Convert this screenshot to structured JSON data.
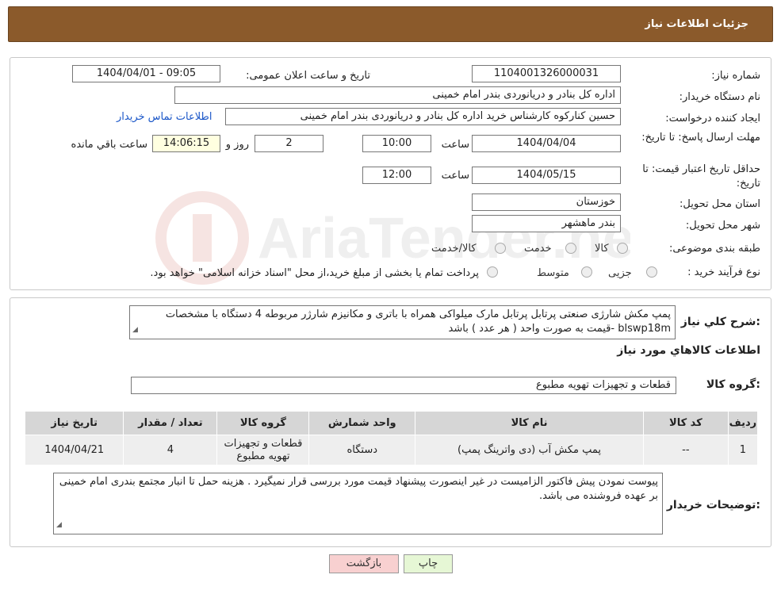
{
  "header": {
    "title": "جزئیات اطلاعات نیاز"
  },
  "form": {
    "need_number_label": "شماره نیاز:",
    "need_number": "1104001326000031",
    "announce_label": "تاریخ و ساعت اعلان عمومی:",
    "announce_value": "1404/04/01 - 09:05",
    "buyer_org_label": "نام دستگاه خریدار:",
    "buyer_org": "اداره کل بنادر و دریانوردی بندر امام خمینی",
    "creator_label": "ایجاد کننده درخواست:",
    "creator": "حسین کنارکوه کارشناس خرید اداره کل بنادر و دریانوردی بندر امام خمینی",
    "contact_link": "اطلاعات تماس خریدار",
    "deadline_label": "مهلت ارسال پاسخ: تا تاریخ:",
    "deadline_date": "1404/04/04",
    "time_label": "ساعت",
    "deadline_time": "10:00",
    "days_value": "2",
    "days_label": "روز و",
    "remaining_time": "14:06:15",
    "remaining_label": "ساعت باقي مانده",
    "validity_label": "حداقل تاریخ اعتبار قیمت: تا تاریخ:",
    "validity_date": "1404/05/15",
    "validity_time": "12:00",
    "province_label": "استان محل تحویل:",
    "province": "خوزستان",
    "city_label": "شهر محل تحویل:",
    "city": "بندر ماهشهر",
    "category_label": "طبقه بندی موضوعی:",
    "category_options": [
      "کالا",
      "خدمت",
      "کالا/خدمت"
    ],
    "process_label": "نوع فرآیند خرید :",
    "process_options": [
      "جزیی",
      "متوسط"
    ],
    "process_note": "پرداخت تمام یا بخشی از مبلغ خرید،از محل \"اسناد خزانه اسلامی\" خواهد بود."
  },
  "description": {
    "label": "شرح کلي نياز:",
    "text": "پمپ مکش شارژی صنعتی پرتابل پرتابل مارک میلواکی همراه با باتری و مکانیزم شارژر مربوطه 4 دستگاه با مشخصات blswp18m -قیمت به صورت واحد ( هر عدد ) باشد"
  },
  "goods": {
    "section_title": "اطلاعات کالاهاي مورد نياز",
    "group_label": "گروه کالا:",
    "group_value": "قطعات و تجهیزات تهویه مطبوع",
    "columns": [
      "ردیف",
      "کد کالا",
      "نام کالا",
      "واحد شمارش",
      "گروه کالا",
      "تعداد / مقدار",
      "تاریخ نیاز"
    ],
    "rows": [
      [
        "1",
        "--",
        "پمپ مکش آب (دی واترینگ پمپ)",
        "دستگاه",
        "قطعات و تجهیزات تهویه مطبوع",
        "4",
        "1404/04/21"
      ]
    ]
  },
  "buyer_notes": {
    "label": "توضیحات خریدار:",
    "text": "پیوست نمودن پیش فاکتور الزامیست در غیر اینصورت پیشنهاد قیمت مورد بررسی قرار نمیگیرد . هزینه حمل تا انبار مجتمع بندری امام خمینی بر عهده فروشنده می باشد."
  },
  "buttons": {
    "print": "چاپ",
    "back": "بازگشت"
  },
  "watermark": "AriaTender.neT",
  "colors": {
    "header_bg": "#8b5a2b",
    "link": "#1a56c8",
    "back_btn": "#f8d0d0",
    "print_btn": "#e6f7d5"
  }
}
